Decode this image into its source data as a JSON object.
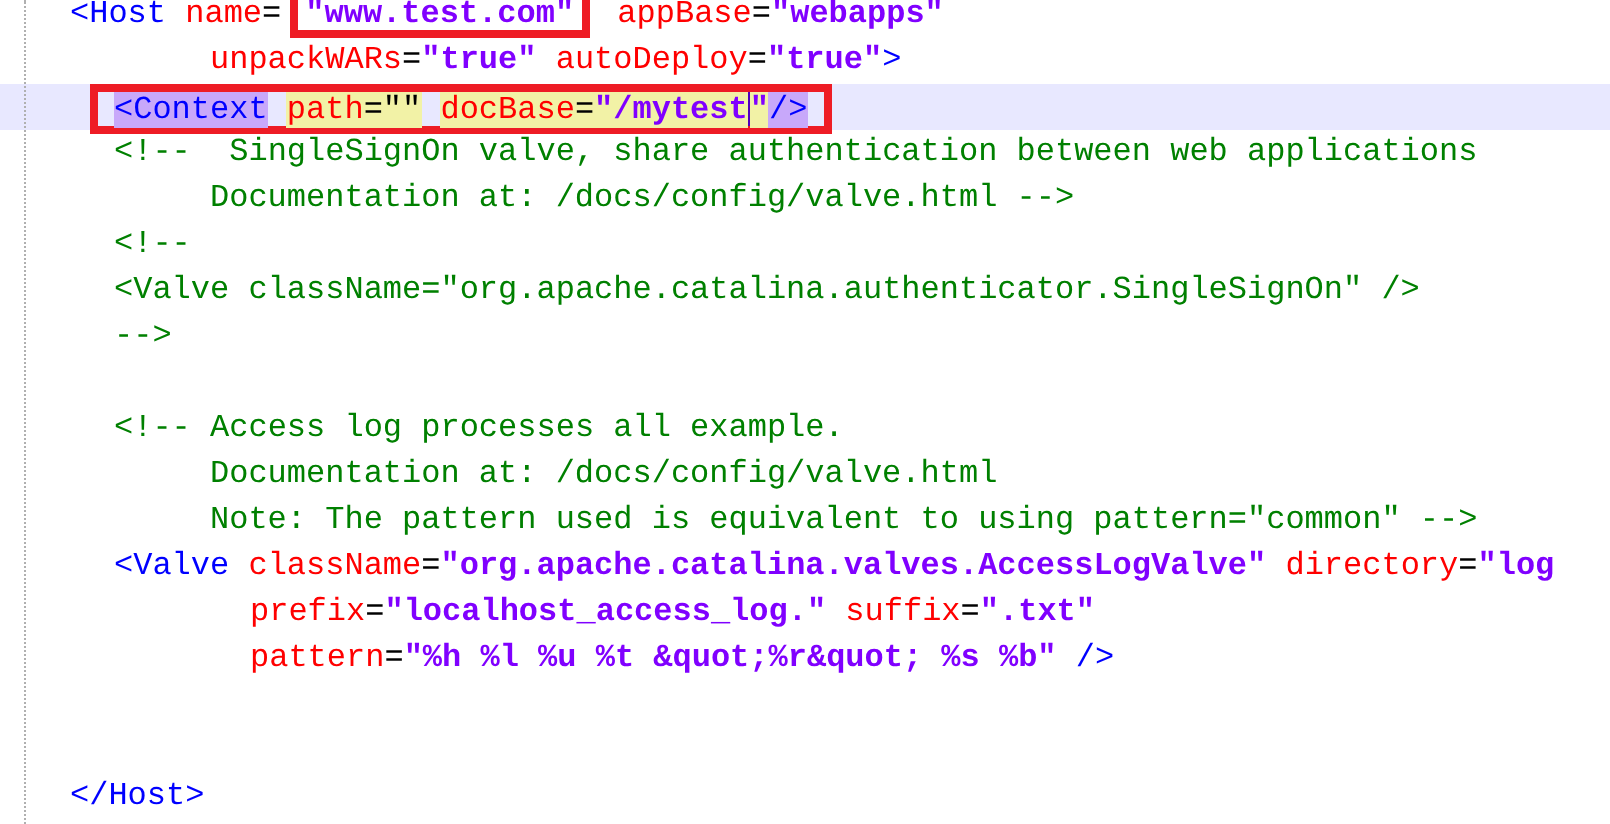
{
  "lines": [
    {
      "kind": "root",
      "segments": [
        {
          "kind": "tag",
          "text": "<Host"
        },
        {
          "kind": "attr",
          "text": " name"
        },
        {
          "kind": "eq",
          "text": "="
        },
        {
          "kind": "value",
          "text": "\"www.test.com\"",
          "boxed": true
        },
        {
          "kind": "attr",
          "text": " appBase"
        },
        {
          "kind": "eq",
          "text": "="
        },
        {
          "kind": "value",
          "text": "\"webapps\""
        }
      ]
    },
    {
      "kind": "continuation",
      "segments": [
        {
          "kind": "attr",
          "text": "unpackWARs"
        },
        {
          "kind": "eq",
          "text": "="
        },
        {
          "kind": "value",
          "text": "\"true\""
        },
        {
          "kind": "attr",
          "text": " autoDeploy"
        },
        {
          "kind": "eq",
          "text": "="
        },
        {
          "kind": "value",
          "text": "\"true\""
        },
        {
          "kind": "tag",
          "text": ">"
        }
      ]
    },
    {
      "kind": "child",
      "current": true,
      "boxed": true,
      "segments": [
        {
          "kind": "tag",
          "text": "<Context",
          "highlighted": true
        },
        {
          "kind": "gap"
        },
        {
          "kind": "attr",
          "text": "path",
          "highlighted": true
        },
        {
          "kind": "eq",
          "text": "=\"\"",
          "highlighted": true
        },
        {
          "kind": "gap"
        },
        {
          "kind": "attr",
          "text": "docBase",
          "highlighted": true
        },
        {
          "kind": "eq",
          "text": "=",
          "highlighted": true
        },
        {
          "kind": "value",
          "text": "\"/mytest",
          "highlighted": true
        },
        {
          "kind": "caret"
        },
        {
          "kind": "value",
          "text": "\"",
          "highlighted": true
        },
        {
          "kind": "tag",
          "text": "/>",
          "highlighted": true
        }
      ]
    },
    {
      "kind": "child",
      "segments": [
        {
          "kind": "comment",
          "text": "<!--  SingleSignOn valve, share authentication between web applications"
        }
      ]
    },
    {
      "kind": "child_continuation",
      "segments": [
        {
          "kind": "comment",
          "text": "Documentation at: /docs/config/valve.html -->"
        }
      ]
    },
    {
      "kind": "child",
      "segments": [
        {
          "kind": "comment",
          "text": "<!--"
        }
      ]
    },
    {
      "kind": "child",
      "segments": [
        {
          "kind": "comment",
          "text": "<Valve className=\"org.apache.catalina.authenticator.SingleSignOn\" />"
        }
      ]
    },
    {
      "kind": "child",
      "segments": [
        {
          "kind": "comment",
          "text": "-->"
        }
      ]
    },
    {
      "kind": "blank"
    },
    {
      "kind": "child",
      "segments": [
        {
          "kind": "comment",
          "text": "<!-- Access log processes all example."
        }
      ]
    },
    {
      "kind": "child_continuation",
      "segments": [
        {
          "kind": "comment",
          "text": "Documentation at: /docs/config/valve.html"
        }
      ]
    },
    {
      "kind": "child_continuation",
      "segments": [
        {
          "kind": "comment",
          "text": "Note: The pattern used is equivalent to using pattern=\"common\" -->"
        }
      ]
    },
    {
      "kind": "child",
      "segments": [
        {
          "kind": "tag",
          "text": "<Valve"
        },
        {
          "kind": "attr",
          "text": " className"
        },
        {
          "kind": "eq",
          "text": "="
        },
        {
          "kind": "value",
          "text": "\"org.apache.catalina.valves.AccessLogValve\""
        },
        {
          "kind": "attr",
          "text": " directory"
        },
        {
          "kind": "eq",
          "text": "="
        },
        {
          "kind": "value",
          "text": "\"log"
        }
      ]
    },
    {
      "kind": "child_attribute",
      "segments": [
        {
          "kind": "attr",
          "text": "prefix"
        },
        {
          "kind": "eq",
          "text": "="
        },
        {
          "kind": "value",
          "text": "\"localhost_access_log.\""
        },
        {
          "kind": "attr",
          "text": " suffix"
        },
        {
          "kind": "eq",
          "text": "="
        },
        {
          "kind": "value",
          "text": "\".txt\""
        }
      ]
    },
    {
      "kind": "child_attribute",
      "segments": [
        {
          "kind": "attr",
          "text": "pattern"
        },
        {
          "kind": "eq",
          "text": "="
        },
        {
          "kind": "value",
          "text": "\"%h %l %u %t &quot;%r&quot; %s %b\""
        },
        {
          "kind": "tag",
          "text": " />"
        }
      ]
    },
    {
      "kind": "blank"
    },
    {
      "kind": "blank"
    },
    {
      "kind": "root",
      "segments": [
        {
          "kind": "tag",
          "text": "</Host>"
        }
      ]
    }
  ]
}
